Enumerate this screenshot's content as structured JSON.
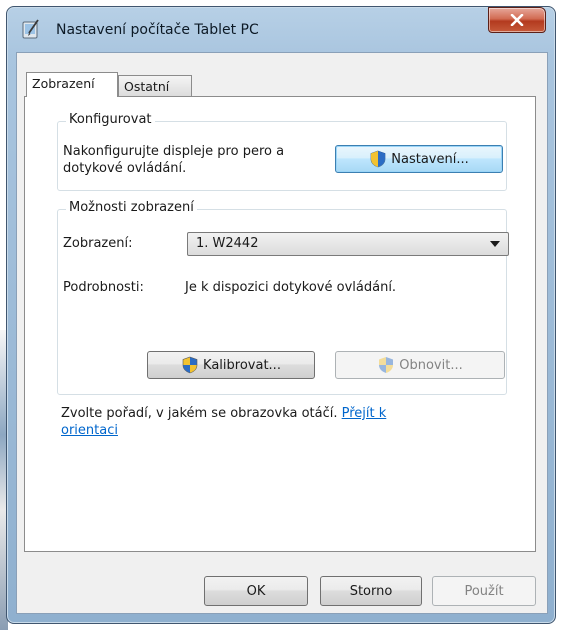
{
  "window": {
    "title": "Nastavení počítače Tablet PC",
    "icon": "tablet-pc-settings-icon",
    "close_icon": "close-icon"
  },
  "tabs": [
    {
      "label": "Zobrazení",
      "active": true
    },
    {
      "label": "Ostatní",
      "active": false
    }
  ],
  "configure": {
    "group_title": "Konfigurovat",
    "description_line1": "Nakonfigurujte displeje pro pero a",
    "description_line2": "dotykové ovládání.",
    "button_label": "Nastavení..."
  },
  "display_options": {
    "group_title": "Možnosti zobrazení",
    "display_label": "Zobrazení:",
    "display_value": "1. W2442",
    "details_label": "Podrobnosti:",
    "details_value": "Je k dispozici dotykové ovládání.",
    "calibrate_label": "Kalibrovat...",
    "reset_label": "Obnovit..."
  },
  "orientation": {
    "text": "Zvolte pořadí, v jakém se obrazovka otáčí.",
    "link_part1": "Přejít k",
    "link_part2": "orientaci"
  },
  "footer": {
    "ok_label": "OK",
    "cancel_label": "Storno",
    "apply_label": "Použít"
  },
  "colors": {
    "link": "#0066cc",
    "shield_blue": "#2b6cc4",
    "shield_yellow": "#f2c230",
    "close_red": "#c65a3a"
  }
}
